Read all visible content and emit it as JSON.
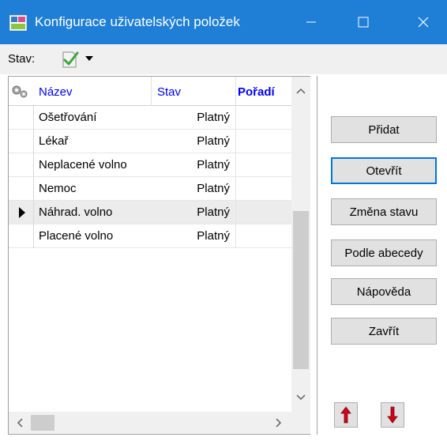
{
  "window": {
    "title": "Konfigurace uživatelských položek",
    "accent_color": "#1f7fd6",
    "icons": {
      "app": "app-icon",
      "minimize": "minimize-icon",
      "maximize": "maximize-icon",
      "close": "close-icon"
    }
  },
  "toolbar": {
    "stav_label": "Stav:",
    "stav_icon": "check-document-icon"
  },
  "table": {
    "columns": [
      "Název",
      "Stav",
      "Pořadí"
    ],
    "rows": [
      {
        "name": "Ošetřování",
        "state": "Platný",
        "order": ""
      },
      {
        "name": "Lékař",
        "state": "Platný",
        "order": ""
      },
      {
        "name": "Neplacené volno",
        "state": "Platný",
        "order": ""
      },
      {
        "name": "Nemoc",
        "state": "Platný",
        "order": ""
      },
      {
        "name": "Náhrad. volno",
        "state": "Platný",
        "order": "",
        "selected": true
      },
      {
        "name": "Placené volno",
        "state": "Platný",
        "order": ""
      }
    ]
  },
  "buttons": {
    "add": "Přidat",
    "open": "Otevřít",
    "change_state": "Změna stavu",
    "alphabetical": "Podle abecedy",
    "help": "Nápověda",
    "close": "Zavřít"
  },
  "colors": {
    "header_text": "#0000ff",
    "arrow_red": "#d0021b"
  }
}
